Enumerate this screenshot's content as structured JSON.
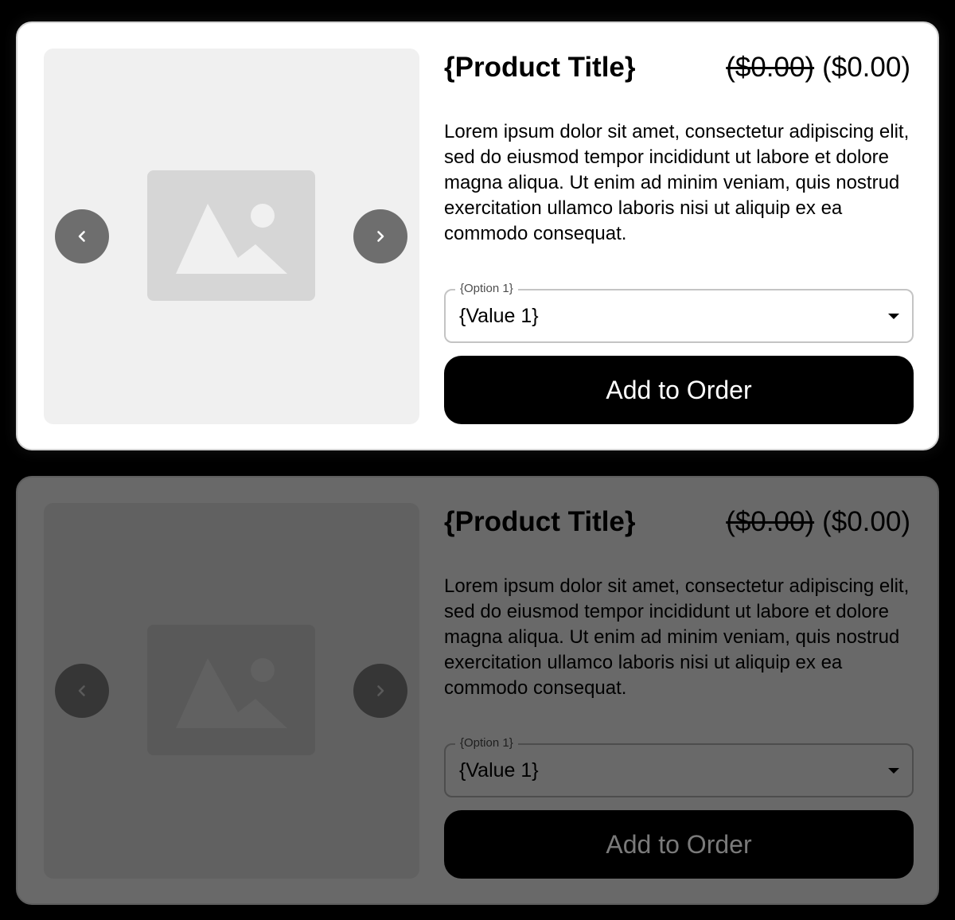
{
  "cards": [
    {
      "state": "enabled",
      "title": "{Product Title}",
      "price_original": "($0.00)",
      "price_current": "($0.00)",
      "description": "Lorem ipsum dolor sit amet, consectetur adipiscing elit, sed do eiusmod tempor incididunt ut labore et dolore magna aliqua. Ut enim ad minim veniam, quis nostrud exercitation ullamco laboris nisi ut aliquip ex ea commodo consequat.",
      "option": {
        "label": "{Option 1}",
        "value": "{Value 1}"
      },
      "cta_label": "Add to Order",
      "icons": {
        "prev": "chevron-left-icon",
        "next": "chevron-right-icon",
        "image": "image-placeholder-icon",
        "caret": "caret-down-icon"
      }
    },
    {
      "state": "disabled",
      "title": "{Product Title}",
      "price_original": "($0.00)",
      "price_current": "($0.00)",
      "description": "Lorem ipsum dolor sit amet, consectetur adipiscing elit, sed do eiusmod tempor incididunt ut labore et dolore magna aliqua. Ut enim ad minim veniam, quis nostrud exercitation ullamco laboris nisi ut aliquip ex ea commodo consequat.",
      "option": {
        "label": "{Option 1}",
        "value": "{Value 1}"
      },
      "cta_label": "Add to Order",
      "icons": {
        "prev": "chevron-left-icon",
        "next": "chevron-right-icon",
        "image": "image-placeholder-icon",
        "caret": "caret-down-icon"
      }
    }
  ],
  "colors": {
    "page_background": "#000000",
    "card_background": "#ffffff",
    "disabled_overlay": "#696969",
    "button_background": "#000000",
    "button_text": "#ffffff",
    "disabled_button_text": "#7a7a7a"
  }
}
